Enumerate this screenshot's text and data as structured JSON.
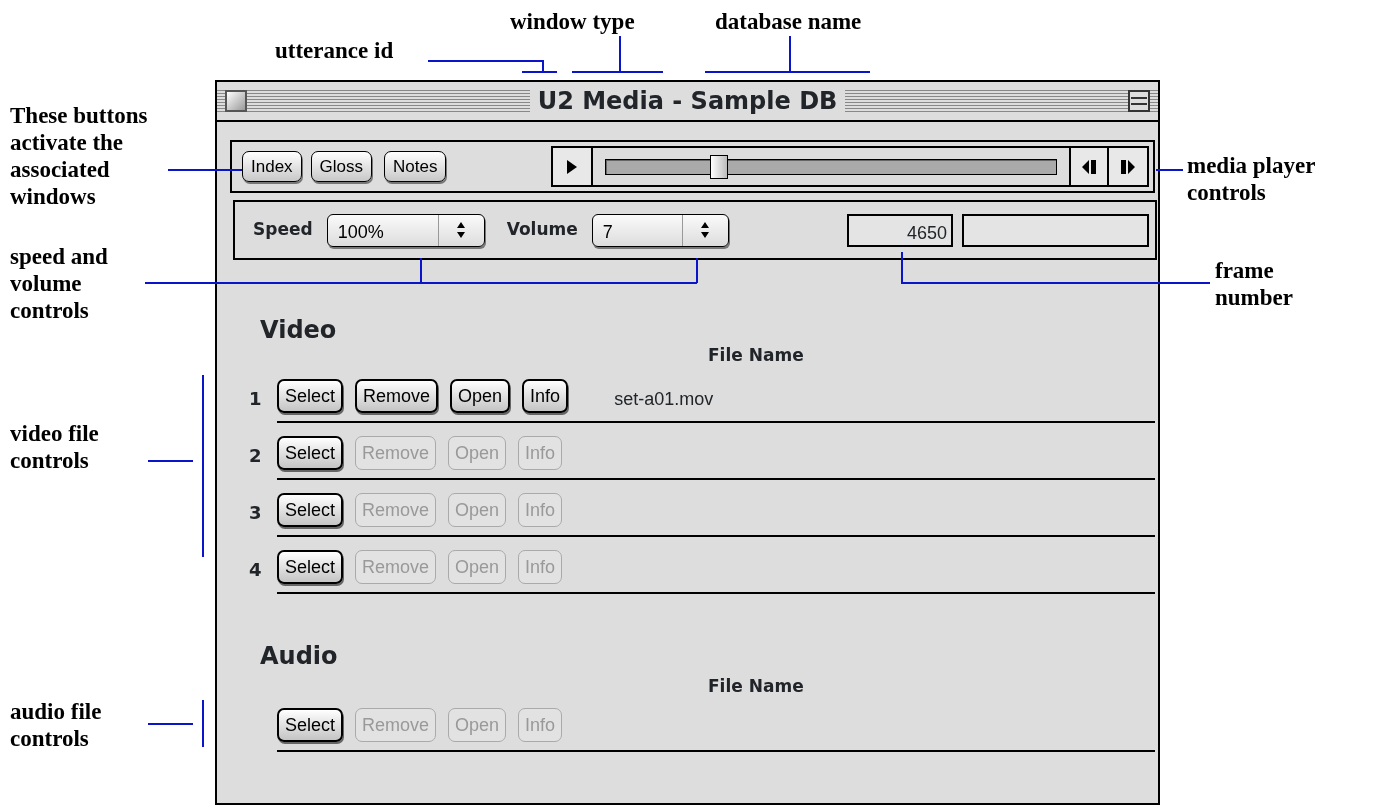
{
  "window": {
    "title": "U2 Media - Sample DB"
  },
  "toolbar": {
    "buttons": [
      {
        "label": "Index"
      },
      {
        "label": "Gloss"
      },
      {
        "label": "Notes"
      }
    ],
    "player": {
      "level": 0.25
    }
  },
  "settings": {
    "speed": {
      "label": "Speed",
      "value": "100%"
    },
    "volume": {
      "label": "Volume",
      "value": "7"
    },
    "frame": "4650"
  },
  "video": {
    "heading": "Video",
    "column": "File Name",
    "rows": [
      {
        "number": "1",
        "file": "set-a01.mov",
        "buttons": [
          {
            "label": "Select",
            "disabled": false
          },
          {
            "label": "Remove",
            "disabled": false
          },
          {
            "label": "Open",
            "disabled": false
          },
          {
            "label": "Info",
            "disabled": false
          }
        ]
      },
      {
        "number": "2",
        "buttons": [
          {
            "label": "Select",
            "disabled": false
          },
          {
            "label": "Remove",
            "disabled": true
          },
          {
            "label": "Open",
            "disabled": true
          },
          {
            "label": "Info",
            "disabled": true
          }
        ]
      },
      {
        "number": "3",
        "buttons": [
          {
            "label": "Select",
            "disabled": false
          },
          {
            "label": "Remove",
            "disabled": true
          },
          {
            "label": "Open",
            "disabled": true
          },
          {
            "label": "Info",
            "disabled": true
          }
        ]
      },
      {
        "number": "4",
        "buttons": [
          {
            "label": "Select",
            "disabled": false
          },
          {
            "label": "Remove",
            "disabled": true
          },
          {
            "label": "Open",
            "disabled": true
          },
          {
            "label": "Info",
            "disabled": true
          }
        ]
      }
    ]
  },
  "audio": {
    "heading": "Audio",
    "column": "File Name",
    "rows": [
      {
        "buttons": [
          {
            "label": "Select",
            "disabled": false
          },
          {
            "label": "Remove",
            "disabled": true
          },
          {
            "label": "Open",
            "disabled": true
          },
          {
            "label": "Info",
            "disabled": true
          }
        ]
      }
    ]
  },
  "annotations": [
    {
      "text": "utterance id"
    },
    {
      "text": "window type"
    },
    {
      "text": "database name"
    },
    {
      "text": "These buttons activate the associated windows"
    },
    {
      "text": "media player controls"
    },
    {
      "text": "speed and volume controls"
    },
    {
      "text": "frame number"
    },
    {
      "text": "video file controls"
    },
    {
      "text": "audio file controls"
    }
  ]
}
